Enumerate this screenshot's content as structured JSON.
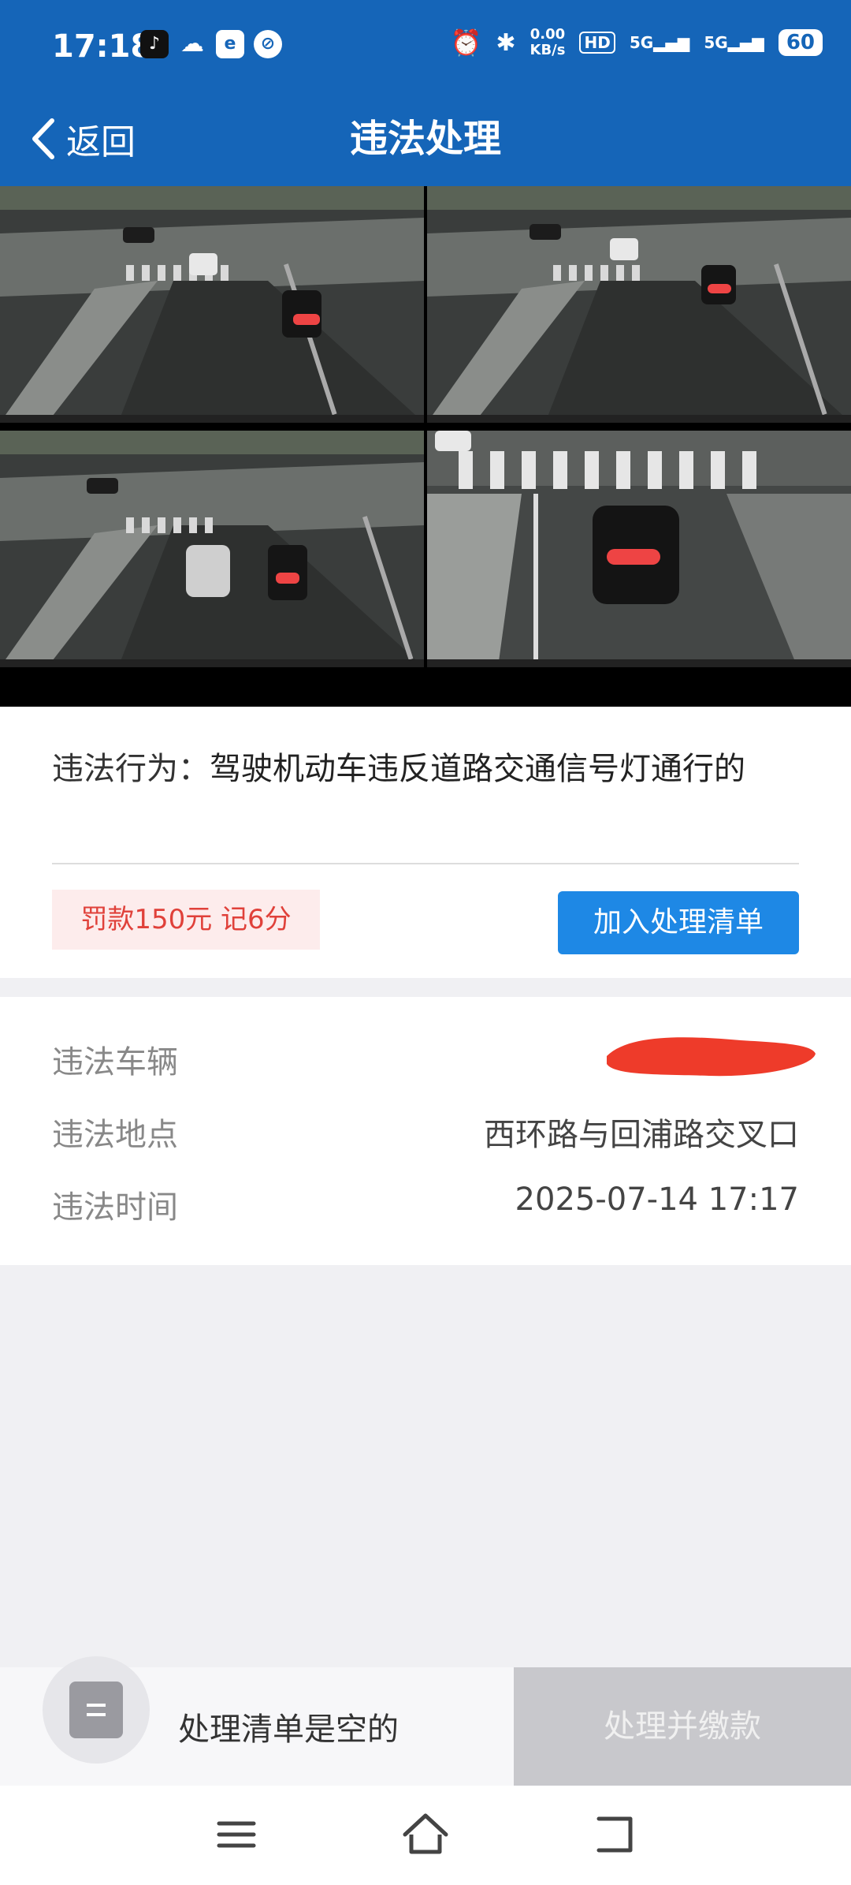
{
  "status_bar": {
    "time": "17:18",
    "net_speed_value": "0.00",
    "net_speed_unit": "KB/s",
    "hd_label": "HD",
    "signal1": "5G",
    "signal2": "5G",
    "battery": "60",
    "icons": [
      "tiktok-icon",
      "cloud-icon",
      "browser-icon",
      "app-icon",
      "alarm-icon",
      "bluetooth-icon"
    ]
  },
  "header": {
    "back_label": "返回",
    "title": "违法处理"
  },
  "photos": {
    "count": 4,
    "active_index": 1
  },
  "violation": {
    "behavior_label": "违法行为：",
    "behavior_text": "驾驶机动车违反道路交通信号灯通行的",
    "fine_badge": "罚款150元 记6分",
    "add_button": "加入处理清单"
  },
  "details": {
    "vehicle_label": "违法车辆",
    "vehicle_value": "",
    "location_label": "违法地点",
    "location_value": "西环路与回浦路交叉口",
    "time_label": "违法时间",
    "time_value": "2025-07-14 17:17"
  },
  "bottom": {
    "empty_text": "处理清单是空的",
    "pay_button": "处理并缴款"
  },
  "colors": {
    "brand_blue": "#1565b8",
    "button_blue": "#1e88e5",
    "fine_red": "#e0413a",
    "disabled_gray": "#c8c8cc"
  }
}
